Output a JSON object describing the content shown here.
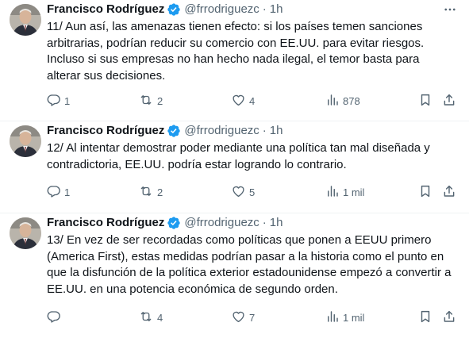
{
  "author": {
    "name": "Francisco Rodríguez",
    "handle": "@frrodriguezc",
    "separator": "·",
    "time": "1h"
  },
  "tweets": [
    {
      "text": "11/ Aun así, las amenazas tienen efecto: si los países temen sanciones arbitrarias, podrían reducir su comercio con EE.UU. para evitar riesgos. Incluso si sus empresas no han hecho nada ilegal, el temor basta para alterar sus decisiones.",
      "replies": "1",
      "reposts": "2",
      "likes": "4",
      "views": "878"
    },
    {
      "text": "12/ Al intentar demostrar poder mediante una política tan mal diseñada y contradictoria, EE.UU. podría estar logrando lo contrario.",
      "replies": "1",
      "reposts": "2",
      "likes": "5",
      "views": "1 mil"
    },
    {
      "text": "13/ En vez de ser recordadas como políticas que ponen a EEUU primero (America First), estas medidas podrían pasar a la historia como el punto en que la disfunción de la política exterior estadounidense empezó a convertir a EE.UU. en una potencia económica de segundo orden.",
      "replies": "",
      "reposts": "4",
      "likes": "7",
      "views": "1 mil"
    }
  ],
  "icons": {
    "more": "more-horizontal-icon",
    "verified": "verified-badge-icon",
    "reply": "reply-icon",
    "repost": "repost-icon",
    "like": "like-icon",
    "views": "views-icon",
    "bookmark": "bookmark-icon",
    "share": "share-icon"
  },
  "colors": {
    "text": "#0f1419",
    "secondary": "#536471",
    "verified": "#1d9bf0",
    "divider": "#eff3f4"
  }
}
